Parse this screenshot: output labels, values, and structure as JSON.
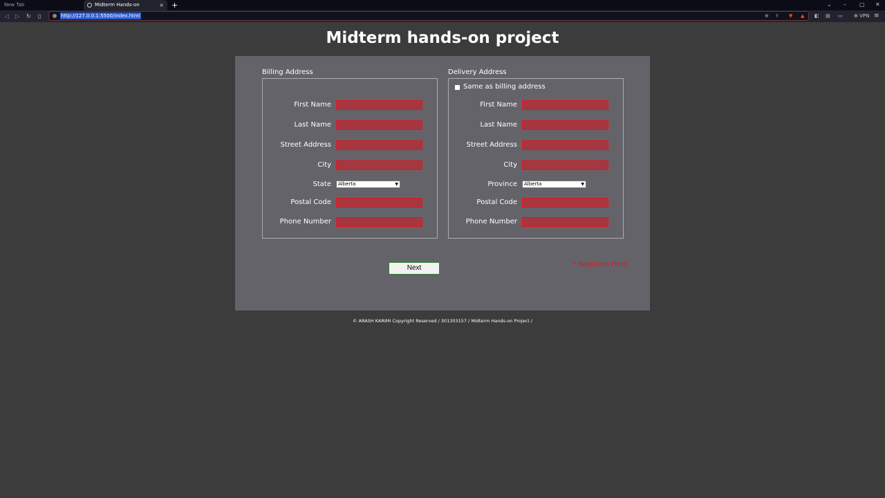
{
  "browser": {
    "tabs": [
      {
        "title": "New Tab",
        "active": false
      },
      {
        "title": "Midterm Hands-on",
        "active": true
      }
    ],
    "new_tab_glyph": "+",
    "close_glyph": "×",
    "url": "http://127.0.0.1:5500/index.html",
    "vpn_label": "⊕ VPN",
    "icons": [
      "back-icon",
      "forward-icon",
      "reload-icon",
      "bookmark-icon",
      "site-info-icon",
      "zoom-icon",
      "share-icon",
      "brave-shields-icon",
      "brave-rewards-icon",
      "extensions-icon",
      "sidebar-icon",
      "wallet-icon",
      "menu-icon"
    ]
  },
  "page": {
    "title": "Midterm hands-on project",
    "billing": {
      "legend": "Billing Address",
      "fields": {
        "first_name": "First Name",
        "last_name": "Last Name",
        "street": "Street Address",
        "city": "City",
        "region_label": "State",
        "region_value": "Alberta",
        "postal": "Postal Code",
        "phone": "Phone Number"
      }
    },
    "delivery": {
      "legend": "Delivery Address",
      "same_as_billing": "Same as billing address",
      "fields": {
        "first_name": "First Name",
        "last_name": "Last Name",
        "street": "Street Address",
        "city": "City",
        "region_label": "Province",
        "region_value": "Alberta",
        "postal": "Postal Code",
        "phone": "Phone Number"
      }
    },
    "next_button": "Next",
    "required_note": "* Required Field",
    "footer": "© ARASH KARIMI Copyright Reserved / 301303157 / Midterm Hands-on Project /"
  },
  "colors": {
    "page_bg": "#3b3c3b",
    "card_bg": "#65636a",
    "input_bg": "#a63640",
    "input_border": "#e8131e",
    "required_text": "#e8131e",
    "url_highlight": "#2f5fd0"
  }
}
